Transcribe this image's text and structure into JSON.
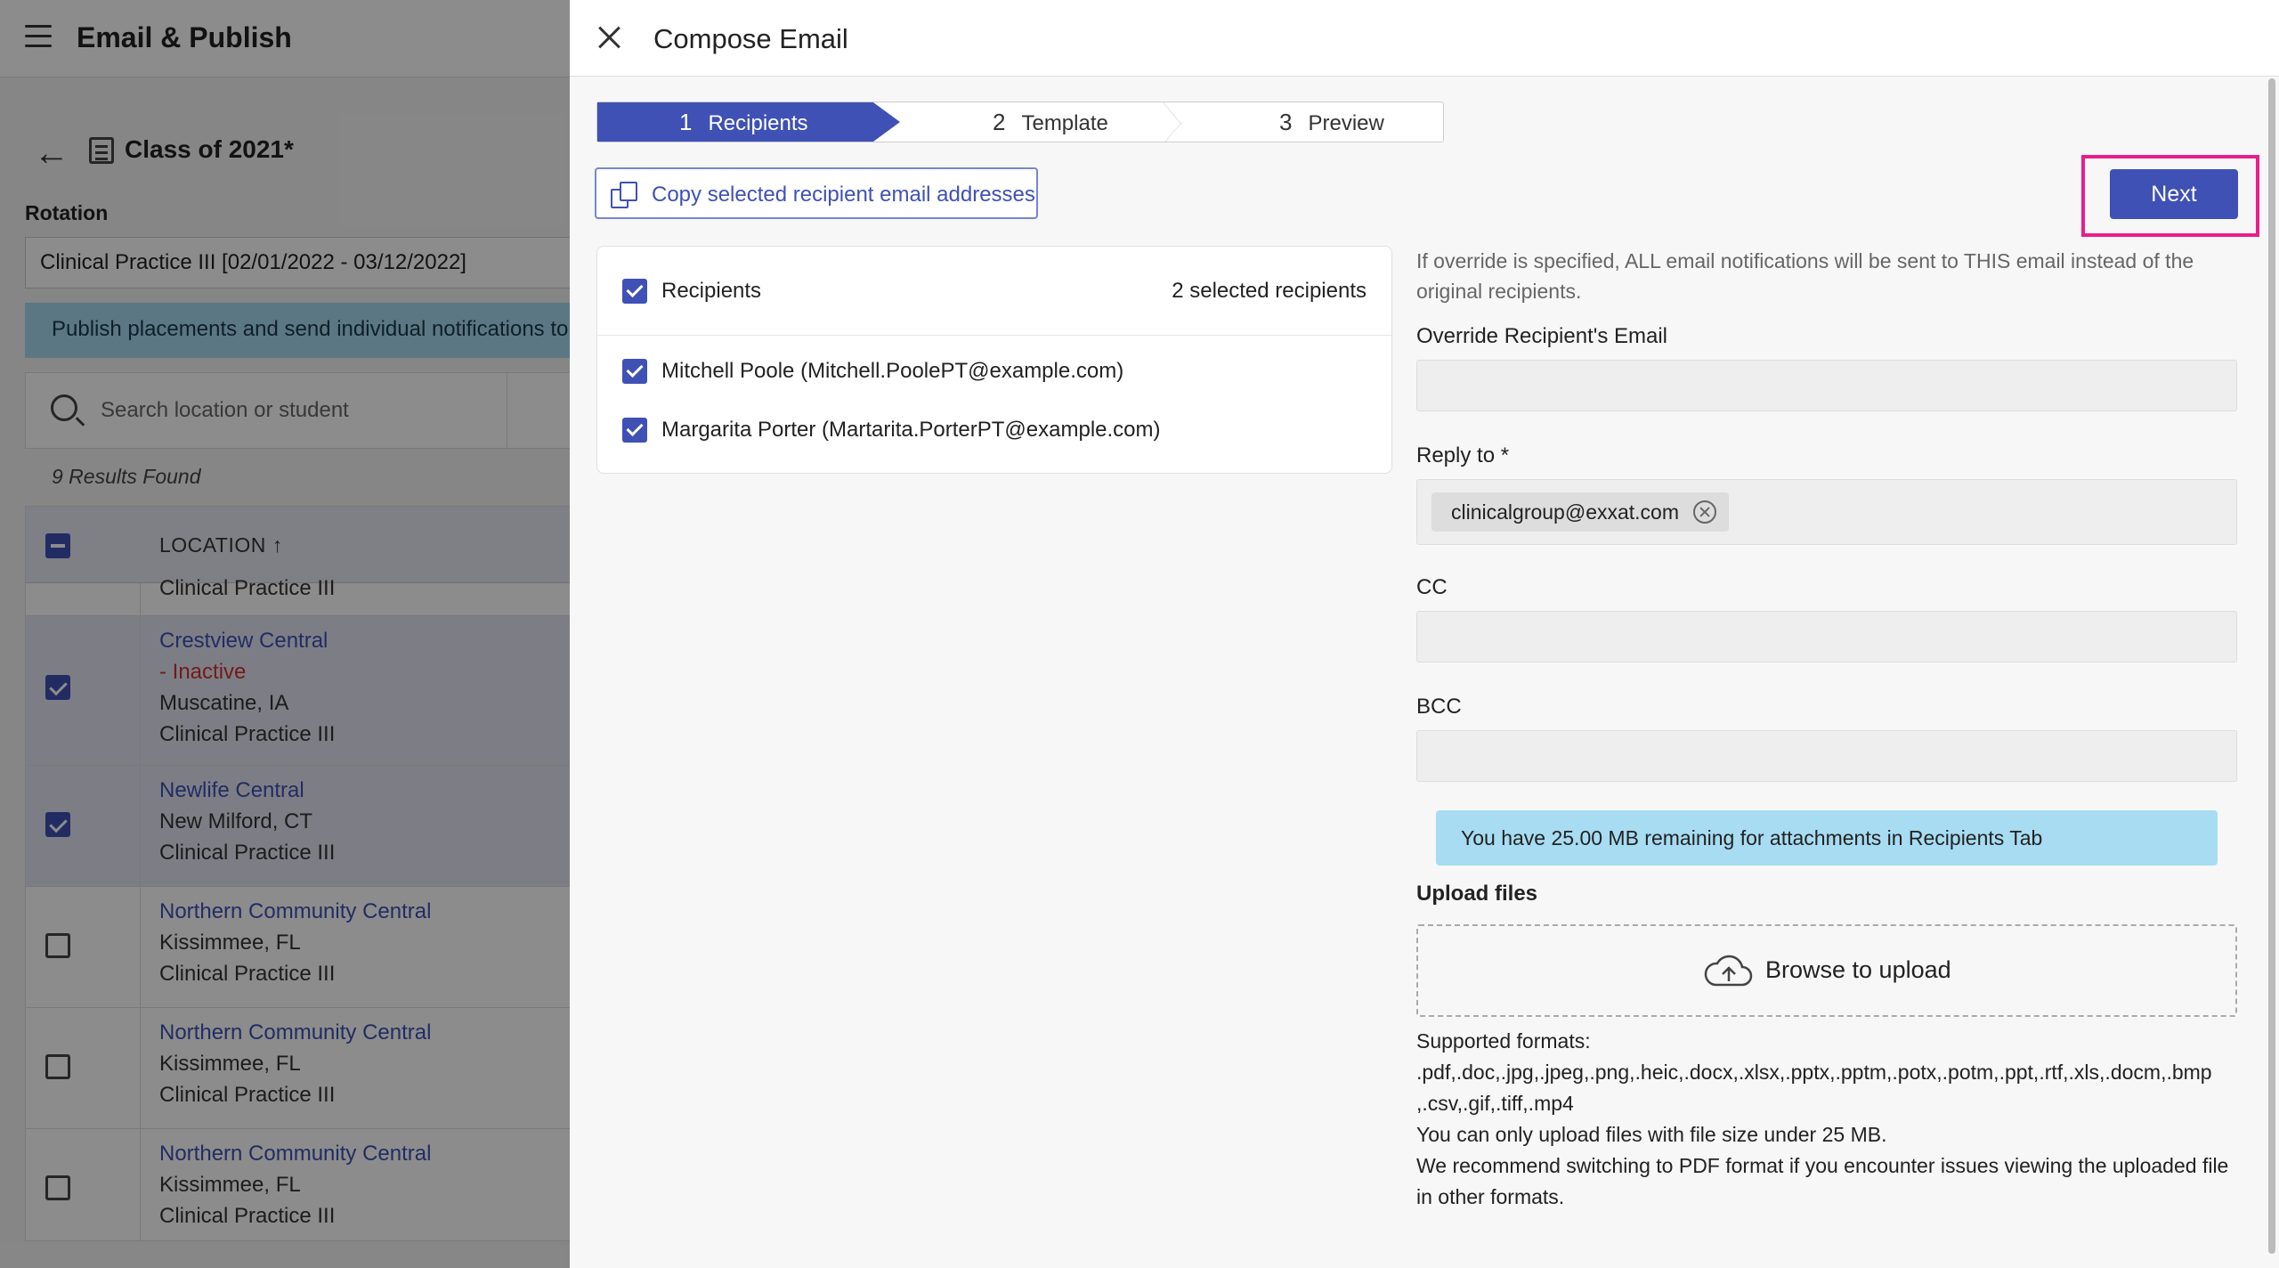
{
  "app": {
    "title": "Email & Publish"
  },
  "page": {
    "class_title": "Class of 2021*",
    "rotation_label": "Rotation",
    "rotation_value": "Clinical Practice III  [02/01/2022 - 03/12/2022]",
    "publish_banner": "Publish placements and send individual notifications to s",
    "search_placeholder": "Search location or student",
    "results_found": "9 Results Found",
    "table": {
      "column_location": "LOCATION",
      "partial_row_text": "Clinical Practice III",
      "rows": [
        {
          "name": "Crestview Central",
          "status": "- Inactive",
          "city": "Muscatine, IA",
          "rotation": "Clinical Practice III",
          "selected": true
        },
        {
          "name": "Newlife Central",
          "city": "New Milford, CT",
          "rotation": "Clinical Practice III",
          "selected": true
        },
        {
          "name": "Northern Community Central",
          "city": "Kissimmee, FL",
          "rotation": "Clinical Practice III",
          "selected": false
        },
        {
          "name": "Northern Community Central",
          "city": "Kissimmee, FL",
          "rotation": "Clinical Practice III",
          "selected": false
        },
        {
          "name": "Northern Community Central",
          "city": "Kissimmee, FL",
          "rotation": "Clinical Practice III",
          "selected": false
        }
      ]
    }
  },
  "compose": {
    "title": "Compose Email",
    "steps": [
      {
        "num": "1",
        "label": "Recipients",
        "active": true
      },
      {
        "num": "2",
        "label": "Template",
        "active": false
      },
      {
        "num": "3",
        "label": "Preview",
        "active": false
      }
    ],
    "copy_button": "Copy selected recipient email addresses",
    "next_button": "Next",
    "recipients": {
      "header_label": "Recipients",
      "count_label": "2 selected recipients",
      "items": [
        "Mitchell Poole (Mitchell.PoolePT@example.com)",
        "Margarita Porter (Martarita.PorterPT@example.com)"
      ]
    },
    "override_note": "If override is specified, ALL email notifications will be sent to THIS email instead of the original recipients.",
    "override_label": "Override Recipient's Email",
    "override_value": "",
    "reply_to_label": "Reply to *",
    "reply_to_chip": "clinicalgroup@exxat.com",
    "cc_label": "CC",
    "cc_value": "",
    "bcc_label": "BCC",
    "bcc_value": "",
    "attachment_banner": "You have 25.00 MB remaining for attachments in Recipients Tab",
    "upload_title": "Upload files",
    "browse_label": "Browse to upload",
    "supported_formats_label": "Supported formats:",
    "supported_formats_line1": ".pdf,.doc,.jpg,.jpeg,.png,.heic,.docx,.xlsx,.pptx,.pptm,.potx,.potm,.ppt,.rtf,.xls,.docm,.bmp",
    "supported_formats_line2": ",.csv,.gif,.tiff,.mp4",
    "size_limit": "You can only upload files with file size under 25 MB.",
    "pdf_recommend_line1": "We recommend switching to PDF format if you encounter issues viewing the uploaded file",
    "pdf_recommend_line2": "in other formats."
  },
  "colors": {
    "primary": "#3f51b5",
    "highlight": "#e91e8c",
    "info_banner": "#a7dcf2",
    "inactive": "#d32f2f"
  }
}
